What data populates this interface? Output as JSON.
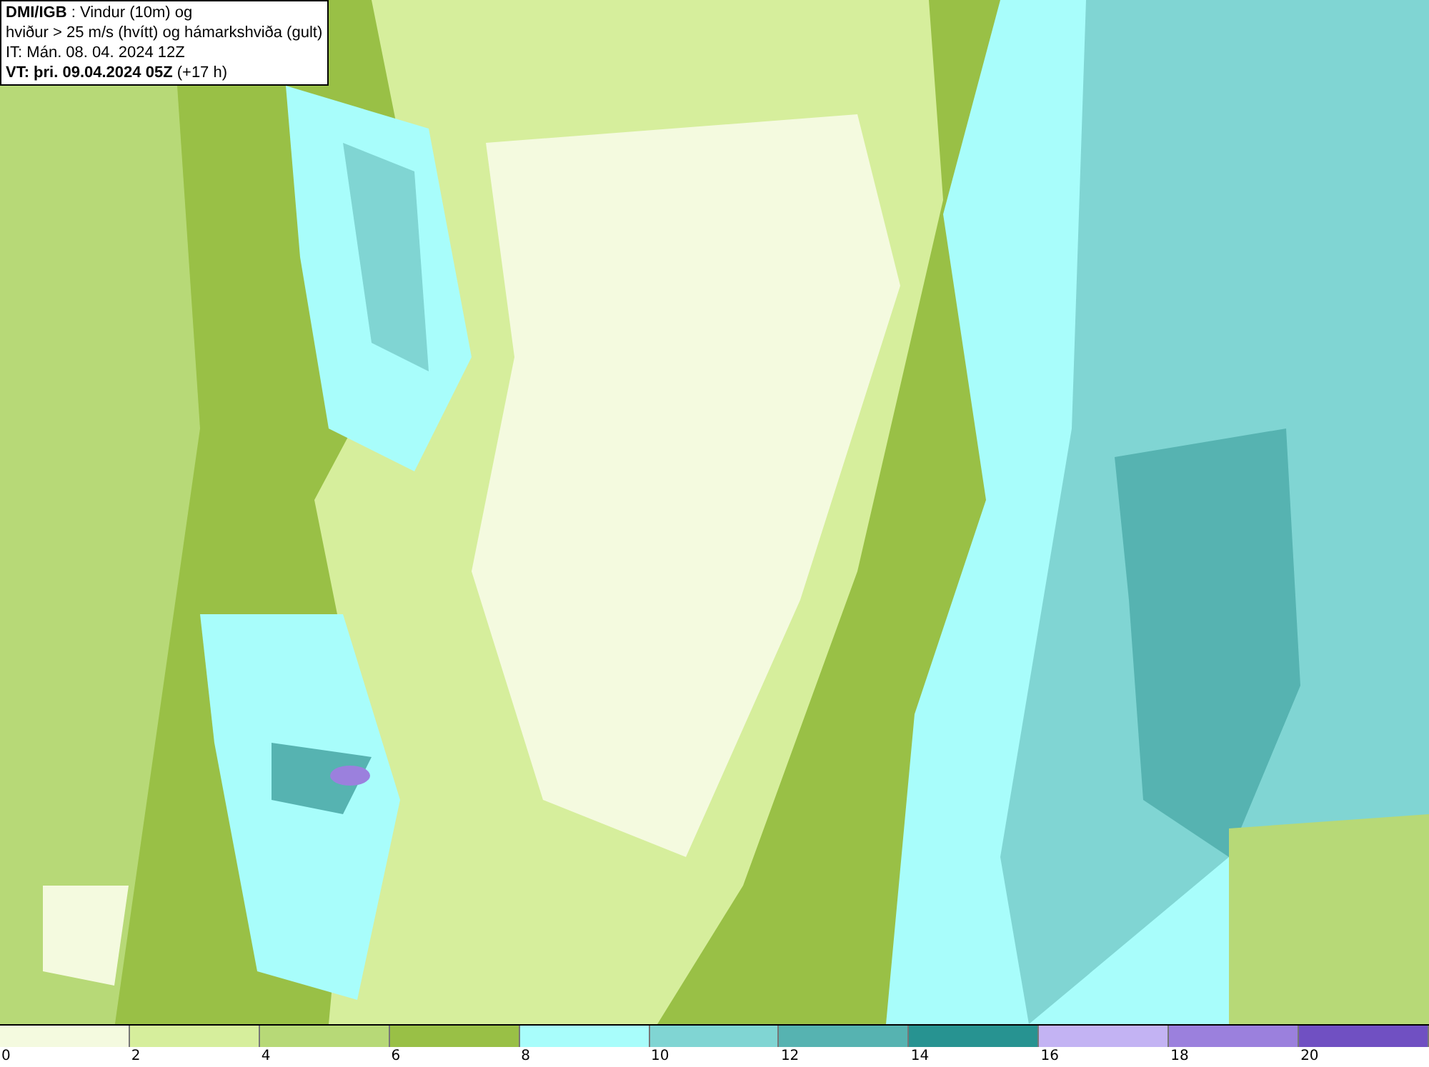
{
  "header": {
    "lines": [
      "**DMI/IGB** : Vindur (10m) og",
      "hviður > 25 m/s (hvítt) og hámarkshviða (gult)",
      "IT: Mán. 08. 04. 2024 12Z",
      "**VT: þri. 09.04.2024 05Z** (+17 h)"
    ]
  },
  "legend": [
    {
      "color": "#f4fadf",
      "label": "0"
    },
    {
      "color": "#d6ee9c",
      "label": "2"
    },
    {
      "color": "#b7d977",
      "label": "4"
    },
    {
      "color": "#99c046",
      "label": "6"
    },
    {
      "color": "#a8fdfb",
      "label": "8"
    },
    {
      "color": "#80d5d3",
      "label": "10"
    },
    {
      "color": "#56b3b1",
      "label": "12"
    },
    {
      "color": "#279391",
      "label": "14"
    },
    {
      "color": "#c3b3f3",
      "label": "16"
    },
    {
      "color": "#9b80dd",
      "label": "18"
    },
    {
      "color": "#7050c2",
      "label": "20"
    }
  ]
}
